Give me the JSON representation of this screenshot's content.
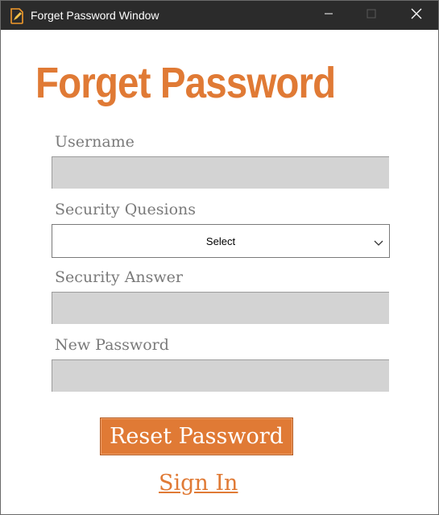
{
  "window": {
    "title": "Forget Password Window",
    "titlebar_color": "#2b2b2b",
    "controls": [
      "minimize-icon",
      "maximize-icon",
      "close-icon"
    ]
  },
  "form": {
    "heading": "Forget Password",
    "username_label": "Username",
    "username_value": "",
    "security_question_label": "Security Quesions",
    "security_question_selected": "Select",
    "security_answer_label": "Security Answer",
    "security_answer_value": "",
    "new_password_label": "New Password",
    "new_password_value": "",
    "reset_button_label": "Reset Password",
    "sign_in_link": "Sign In"
  },
  "colors": {
    "accent": "#e07a35",
    "field_background": "#d3d3d3",
    "label_text": "#7a7a7a"
  }
}
